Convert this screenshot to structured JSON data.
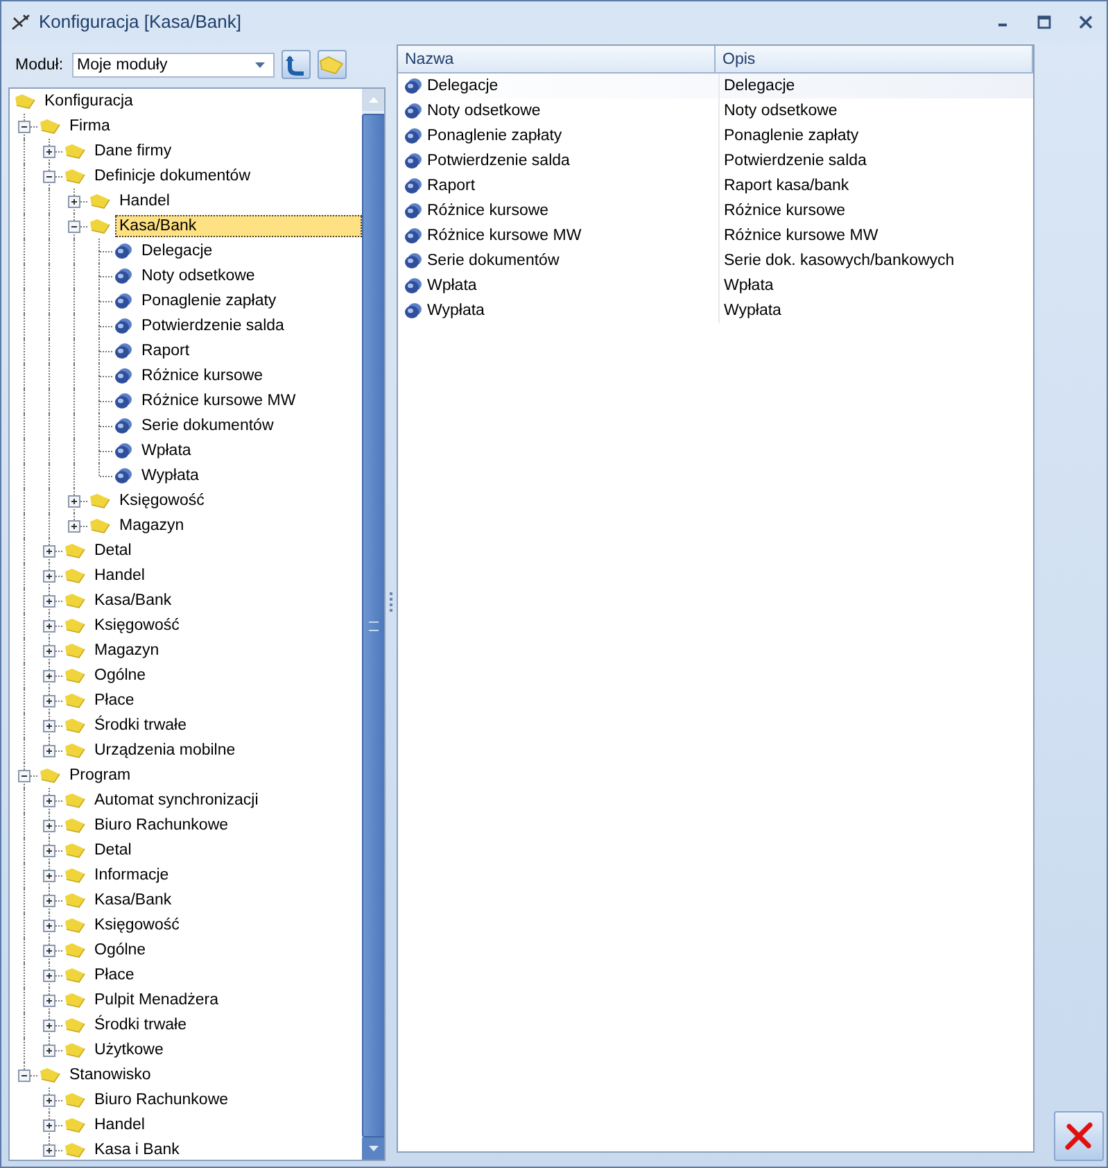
{
  "window": {
    "title": "Konfiguracja [Kasa/Bank]"
  },
  "module": {
    "label": "Moduł:",
    "value": "Moje moduły"
  },
  "tree": {
    "items": [
      {
        "label": "Konfiguracja",
        "kind": "folder",
        "selected": false,
        "children": [
          {
            "label": "Firma",
            "kind": "folder",
            "expanded": true,
            "selected": false,
            "children": [
              {
                "label": "Dane firmy",
                "kind": "folder",
                "expanded": false,
                "selected": false
              },
              {
                "label": "Definicje dokumentów",
                "kind": "folder",
                "expanded": true,
                "selected": false,
                "children": [
                  {
                    "label": "Handel",
                    "kind": "folder",
                    "expanded": false,
                    "selected": false
                  },
                  {
                    "label": "Kasa/Bank",
                    "kind": "folder",
                    "expanded": true,
                    "selected": true,
                    "children": [
                      {
                        "label": "Delegacje",
                        "kind": "document",
                        "selected": false
                      },
                      {
                        "label": "Noty odsetkowe",
                        "kind": "document",
                        "selected": false
                      },
                      {
                        "label": "Ponaglenie zapłaty",
                        "kind": "document",
                        "selected": false
                      },
                      {
                        "label": "Potwierdzenie salda",
                        "kind": "document",
                        "selected": false
                      },
                      {
                        "label": "Raport",
                        "kind": "document",
                        "selected": false
                      },
                      {
                        "label": "Różnice kursowe",
                        "kind": "document",
                        "selected": false
                      },
                      {
                        "label": "Różnice kursowe MW",
                        "kind": "document",
                        "selected": false
                      },
                      {
                        "label": "Serie dokumentów",
                        "kind": "document",
                        "selected": false
                      },
                      {
                        "label": "Wpłata",
                        "kind": "document",
                        "selected": false
                      },
                      {
                        "label": "Wypłata",
                        "kind": "document",
                        "selected": false
                      }
                    ]
                  },
                  {
                    "label": "Księgowość",
                    "kind": "folder",
                    "expanded": false,
                    "selected": false
                  },
                  {
                    "label": "Magazyn",
                    "kind": "folder",
                    "expanded": false,
                    "selected": false
                  }
                ]
              },
              {
                "label": "Detal",
                "kind": "folder",
                "expanded": false,
                "selected": false
              },
              {
                "label": "Handel",
                "kind": "folder",
                "expanded": false,
                "selected": false
              },
              {
                "label": "Kasa/Bank",
                "kind": "folder",
                "expanded": false,
                "selected": false
              },
              {
                "label": "Księgowość",
                "kind": "folder",
                "expanded": false,
                "selected": false
              },
              {
                "label": "Magazyn",
                "kind": "folder",
                "expanded": false,
                "selected": false
              },
              {
                "label": "Ogólne",
                "kind": "folder",
                "expanded": false,
                "selected": false
              },
              {
                "label": "Płace",
                "kind": "folder",
                "expanded": false,
                "selected": false
              },
              {
                "label": "Środki trwałe",
                "kind": "folder",
                "expanded": false,
                "selected": false
              },
              {
                "label": "Urządzenia mobilne",
                "kind": "folder",
                "expanded": false,
                "selected": false
              }
            ]
          },
          {
            "label": "Program",
            "kind": "folder",
            "expanded": true,
            "selected": false,
            "children": [
              {
                "label": "Automat synchronizacji",
                "kind": "folder",
                "expanded": false,
                "selected": false
              },
              {
                "label": "Biuro Rachunkowe",
                "kind": "folder",
                "expanded": false,
                "selected": false
              },
              {
                "label": "Detal",
                "kind": "folder",
                "expanded": false,
                "selected": false
              },
              {
                "label": "Informacje",
                "kind": "folder",
                "expanded": false,
                "selected": false
              },
              {
                "label": "Kasa/Bank",
                "kind": "folder",
                "expanded": false,
                "selected": false
              },
              {
                "label": "Księgowość",
                "kind": "folder",
                "expanded": false,
                "selected": false
              },
              {
                "label": "Ogólne",
                "kind": "folder",
                "expanded": false,
                "selected": false
              },
              {
                "label": "Płace",
                "kind": "folder",
                "expanded": false,
                "selected": false
              },
              {
                "label": "Pulpit Menadżera",
                "kind": "folder",
                "expanded": false,
                "selected": false
              },
              {
                "label": "Środki trwałe",
                "kind": "folder",
                "expanded": false,
                "selected": false
              },
              {
                "label": "Użytkowe",
                "kind": "folder",
                "expanded": false,
                "selected": false
              }
            ]
          },
          {
            "label": "Stanowisko",
            "kind": "folder",
            "expanded": true,
            "selected": false,
            "children": [
              {
                "label": "Biuro Rachunkowe",
                "kind": "folder",
                "expanded": false,
                "selected": false
              },
              {
                "label": "Handel",
                "kind": "folder",
                "expanded": false,
                "selected": false
              },
              {
                "label": "Kasa i Bank",
                "kind": "folder",
                "expanded": false,
                "selected": false
              }
            ]
          }
        ]
      }
    ]
  },
  "table": {
    "columns": [
      "Nazwa",
      "Opis"
    ],
    "rows": [
      {
        "name": "Delegacje",
        "description": "Delegacje",
        "selected": true
      },
      {
        "name": "Noty odsetkowe",
        "description": "Noty odsetkowe",
        "selected": false
      },
      {
        "name": "Ponaglenie zapłaty",
        "description": "Ponaglenie zapłaty",
        "selected": false
      },
      {
        "name": "Potwierdzenie salda",
        "description": "Potwierdzenie salda",
        "selected": false
      },
      {
        "name": "Raport",
        "description": "Raport kasa/bank",
        "selected": false
      },
      {
        "name": "Różnice kursowe",
        "description": "Różnice kursowe",
        "selected": false
      },
      {
        "name": "Różnice kursowe MW",
        "description": "Różnice kursowe MW",
        "selected": false
      },
      {
        "name": "Serie dokumentów",
        "description": "Serie dok. kasowych/bankowych",
        "selected": false
      },
      {
        "name": "Wpłata",
        "description": "Wpłata",
        "selected": false
      },
      {
        "name": "Wypłata",
        "description": "Wypłata",
        "selected": false
      }
    ]
  }
}
